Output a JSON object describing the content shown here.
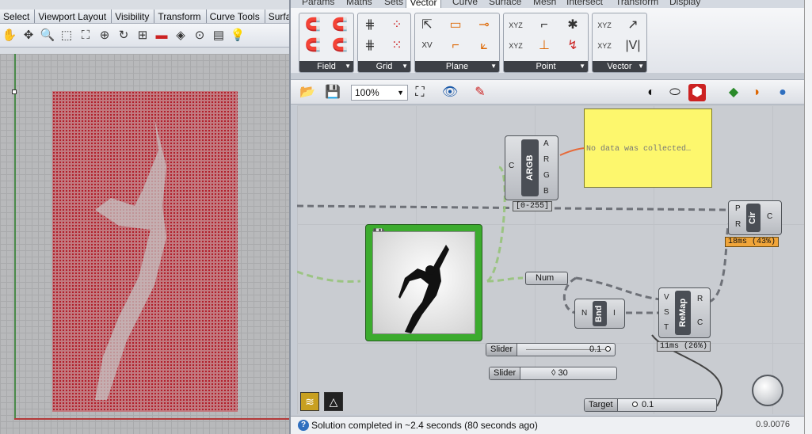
{
  "rhino": {
    "tabs": [
      "Select",
      "Viewport Layout",
      "Visibility",
      "Transform",
      "Curve Tools",
      "Surfa"
    ],
    "toolbar_icons": [
      "hand-icon",
      "pan-icon",
      "zoom-icon",
      "zoom-window-icon",
      "zoom-extents-icon",
      "zoom-selected-icon",
      "rotate-icon",
      "four-viewports-icon",
      "car-icon",
      "properties-icon",
      "circle-icon",
      "layer-icon",
      "bulb-icon"
    ]
  },
  "grasshopper": {
    "tabs": [
      "Params",
      "Maths",
      "Sets",
      "Vector",
      "Curve",
      "Surface",
      "Mesh",
      "Intersect",
      "Transform",
      "Display"
    ],
    "active_tab": "Vector",
    "ribbon_groups": [
      {
        "label": "Field"
      },
      {
        "label": "Grid"
      },
      {
        "label": "Plane"
      },
      {
        "label": "Point"
      },
      {
        "label": "Vector"
      }
    ],
    "zoom": "100%",
    "components": {
      "argb": {
        "name": "ARGB",
        "input": "C",
        "outputs": [
          "A",
          "R",
          "G",
          "B"
        ],
        "range": "[0-255]"
      },
      "panel": {
        "text": "No data was collected…"
      },
      "circle": {
        "name": "Cir",
        "inputs": [
          "P",
          "R"
        ],
        "output": "C",
        "timer": "18ms (43%)"
      },
      "number": {
        "name": "Num"
      },
      "bounds": {
        "name": "Bnd",
        "input": "N",
        "output": "I"
      },
      "remap": {
        "name": "ReMap",
        "inputs": [
          "V",
          "S",
          "T"
        ],
        "outputs": [
          "R",
          "C"
        ],
        "timer": "11ms (26%)"
      }
    },
    "sliders": [
      {
        "name": "Slider",
        "value": "0.1"
      },
      {
        "name": "Slider",
        "value": "◊ 30"
      },
      {
        "name": "Target",
        "value": "0.1"
      }
    ],
    "status": "Solution completed in ~2.4 seconds (80 seconds ago)",
    "version": "0.9.0076"
  }
}
